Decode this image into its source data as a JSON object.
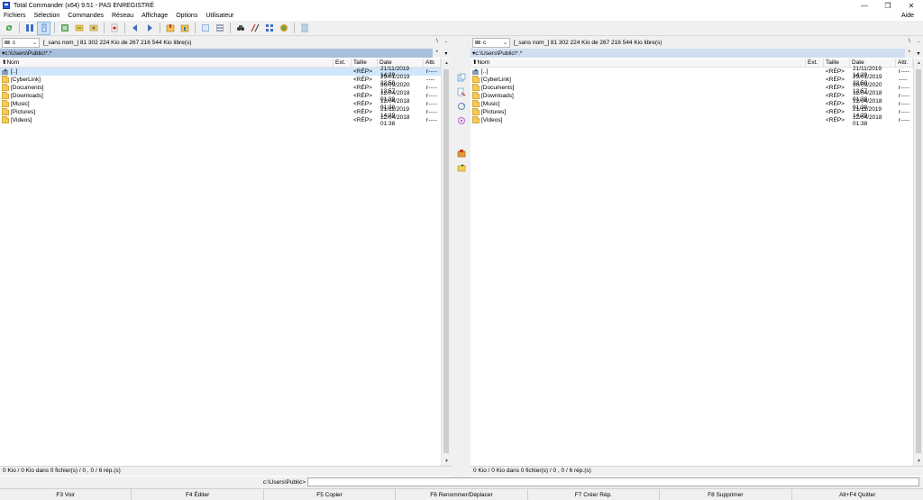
{
  "window": {
    "title": "Total Commander (x64) 9.51 - PAS ENREGISTRÉ",
    "minimize": "—",
    "maximize": "❐",
    "close": "✕"
  },
  "menu": {
    "items": [
      "Fichiers",
      "Sélection",
      "Commandes",
      "Réseau",
      "Affichage",
      "Options",
      "Utilisateur"
    ],
    "help": "Aide"
  },
  "toolbar": {
    "buttons": [
      "refresh-icon",
      "brief-view-icon",
      "detailed-view-icon",
      "thumbnails-view-icon",
      "tree-view-icon",
      "sync-icon",
      "pack-icon",
      "back-icon",
      "forward-icon",
      "zip-icon",
      "unzip-icon",
      "find-icon",
      "multi-rename-icon",
      "search-icon",
      "compare-icon",
      "ftp-icon",
      "copy-names-icon",
      "notepad-icon"
    ]
  },
  "left_panel": {
    "drive": "c",
    "drive_chevron": "⌄",
    "drive_info": "[_sans nom_]  81 302 224 Kio de 267 216 544 Kio libre(s)",
    "root_btn": "\\",
    "parent_btn": "..",
    "path": "c:\\Users\\Public\\*.*",
    "path_arrow": "▾",
    "path_star": "*",
    "path_dropdown": "▾",
    "columns": {
      "name": "Nom",
      "ext": "Ext.",
      "size": "Taille",
      "date": "Date",
      "attr": "Attr."
    },
    "sort_arrow": "⬆",
    "rows": [
      {
        "name": "[..]",
        "size": "<RÉP>",
        "date": "21/11/2019 14:29",
        "attr": "r----"
      },
      {
        "name": "[CyberLink]",
        "size": "<RÉP>",
        "date": "29/01/2019 22:50",
        "attr": "----"
      },
      {
        "name": "[Documents]",
        "size": "<RÉP>",
        "date": "30/09/2020 12:57",
        "attr": "r----"
      },
      {
        "name": "[Downloads]",
        "size": "<RÉP>",
        "date": "12/04/2018 01:38",
        "attr": "r----"
      },
      {
        "name": "[Music]",
        "size": "<RÉP>",
        "date": "12/04/2018 01:38",
        "attr": "r----"
      },
      {
        "name": "[Pictures]",
        "size": "<RÉP>",
        "date": "21/11/2019 14:29",
        "attr": "r----"
      },
      {
        "name": "[Videos]",
        "size": "<RÉP>",
        "date": "12/04/2018 01:38",
        "attr": "r----"
      }
    ],
    "status": "0 Kio / 0 Kio dans 0 fichier(s) / 0 , 0 / 6 rép.(s)"
  },
  "right_panel": {
    "drive": "c",
    "drive_chevron": "⌄",
    "drive_info": "[_sans nom_]  81 302 224 Kio de 267 216 544 Kio libre(s)",
    "root_btn": "\\",
    "parent_btn": "..",
    "path": "c:\\Users\\Public\\*.*",
    "path_arrow": "▾",
    "path_star": "*",
    "path_dropdown": "▾",
    "columns": {
      "name": "Nom",
      "ext": "Ext.",
      "size": "Taille",
      "date": "Date",
      "attr": "Attr."
    },
    "sort_arrow": "⬆",
    "rows": [
      {
        "name": "[..]",
        "size": "<RÉP>",
        "date": "21/11/2019 14:29",
        "attr": "r----"
      },
      {
        "name": "[CyberLink]",
        "size": "<RÉP>",
        "date": "29/01/2019 22:50",
        "attr": "----"
      },
      {
        "name": "[Documents]",
        "size": "<RÉP>",
        "date": "30/09/2020 12:57",
        "attr": "r----"
      },
      {
        "name": "[Downloads]",
        "size": "<RÉP>",
        "date": "12/04/2018 01:38",
        "attr": "r----"
      },
      {
        "name": "[Music]",
        "size": "<RÉP>",
        "date": "12/04/2018 01:38",
        "attr": "r----"
      },
      {
        "name": "[Pictures]",
        "size": "<RÉP>",
        "date": "21/11/2019 14:29",
        "attr": "r----"
      },
      {
        "name": "[Videos]",
        "size": "<RÉP>",
        "date": "12/04/2018 01:38",
        "attr": "r----"
      }
    ],
    "status": "0 Kio / 0 Kio dans 0 fichier(s) / 0 , 0 / 6 rép.(s)"
  },
  "scrollbar": {
    "up": "▲",
    "down": "▼"
  },
  "middle_bar": {
    "buttons": [
      "copy-panel-icon",
      "move-panel-icon",
      "swap-icon",
      "compare-dirs-icon",
      "pack-files-icon",
      "new-folder-icon"
    ]
  },
  "command_line": {
    "label": "c:\\Users\\Public>",
    "value": ""
  },
  "fkeys": [
    "F3 Voir",
    "F4 Éditer",
    "F5 Copier",
    "F6 Renommer/Déplacer",
    "F7 Créer Rép.",
    "F8 Supprimer",
    "Alt+F4 Quitter"
  ],
  "colors": {
    "active_path": "#a7bfdc",
    "inactive_path": "#cfdff1",
    "cursor_row": "#cfe6fb",
    "folder": "#f5cc5a"
  }
}
